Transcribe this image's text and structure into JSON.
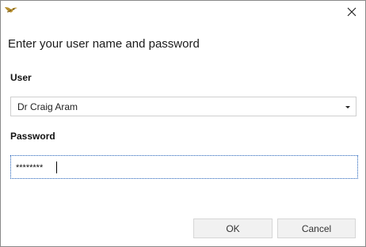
{
  "window": {
    "close_icon": "close-icon",
    "app_icon": "bird-logo-icon"
  },
  "dialog": {
    "heading": "Enter your user name and password",
    "user_label": "User",
    "user_value": "Dr Craig Aram",
    "password_label": "Password",
    "password_value": "********",
    "ok_label": "OK",
    "cancel_label": "Cancel"
  }
}
